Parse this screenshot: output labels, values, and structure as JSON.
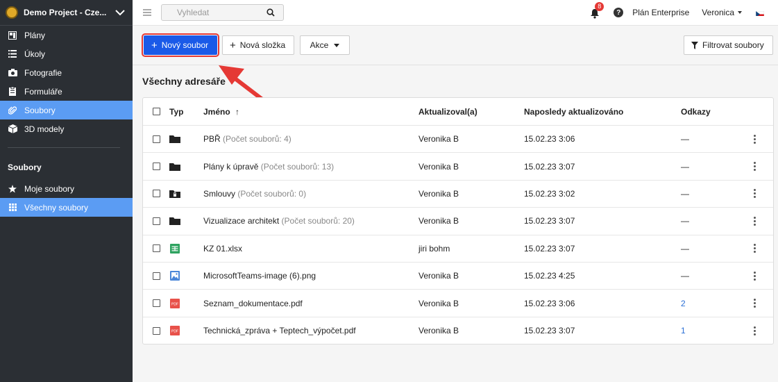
{
  "project": {
    "name": "Demo Project - Cze..."
  },
  "sidebar": {
    "items": [
      {
        "label": "Plány",
        "icon": "plans-icon"
      },
      {
        "label": "Úkoly",
        "icon": "tasks-icon"
      },
      {
        "label": "Fotografie",
        "icon": "camera-icon"
      },
      {
        "label": "Formuláře",
        "icon": "clipboard-icon"
      },
      {
        "label": "Soubory",
        "icon": "paperclip-icon",
        "active": true
      },
      {
        "label": "3D modely",
        "icon": "cube-icon"
      }
    ],
    "section_title": "Soubory",
    "sub_items": [
      {
        "label": "Moje soubory",
        "icon": "star-icon"
      },
      {
        "label": "Všechny soubory",
        "icon": "grid-icon",
        "active": true
      }
    ]
  },
  "topbar": {
    "search_placeholder": "Vyhledat",
    "notifications_count": "8",
    "help": "?",
    "plan": "Plán Enterprise",
    "user": "Veronica"
  },
  "toolbar": {
    "new_file": "Nový soubor",
    "new_folder": "Nová složka",
    "actions": "Akce",
    "filter": "Filtrovat soubory"
  },
  "content": {
    "title": "Všechny adresáře",
    "columns": {
      "type": "Typ",
      "name": "Jméno",
      "updated_by": "Aktualizoval(a)",
      "last_updated": "Naposledy aktualizováno",
      "links": "Odkazy"
    },
    "rows": [
      {
        "type": "folder",
        "name": "PBŘ",
        "count": "(Počet souborů: 4)",
        "updated_by": "Veronika B",
        "date": "15.02.23 3:06",
        "links": "—"
      },
      {
        "type": "folder",
        "name": "Plány k úpravě",
        "count": "(Počet souborů: 13)",
        "updated_by": "Veronika B",
        "date": "15.02.23 3:07",
        "links": "—"
      },
      {
        "type": "folder-locked",
        "name": "Smlouvy",
        "count": "(Počet souborů: 0)",
        "updated_by": "Veronika B",
        "date": "15.02.23 3:02",
        "links": "—"
      },
      {
        "type": "folder",
        "name": "Vizualizace architekt",
        "count": "(Počet souborů: 20)",
        "updated_by": "Veronika B",
        "date": "15.02.23 3:07",
        "links": "—"
      },
      {
        "type": "xlsx",
        "name": "KZ 01.xlsx",
        "count": "",
        "updated_by": "jiri bohm",
        "date": "15.02.23 3:07",
        "links": "—"
      },
      {
        "type": "image",
        "name": "MicrosoftTeams-image (6).png",
        "count": "",
        "updated_by": "Veronika B",
        "date": "15.02.23 4:25",
        "links": "—"
      },
      {
        "type": "pdf",
        "name": "Seznam_dokumentace.pdf",
        "count": "",
        "updated_by": "Veronika B",
        "date": "15.02.23 3:06",
        "links": "2"
      },
      {
        "type": "pdf",
        "name": "Technická_zpráva + Teptech_výpočet.pdf",
        "count": "",
        "updated_by": "Veronika B",
        "date": "15.02.23 3:07",
        "links": "1"
      }
    ]
  },
  "colors": {
    "accent": "#1a5ae8",
    "active_nav": "#5b9cf3",
    "sidebar_bg": "#2b2f34",
    "highlight": "#e53935",
    "link": "#2a6fd6"
  }
}
